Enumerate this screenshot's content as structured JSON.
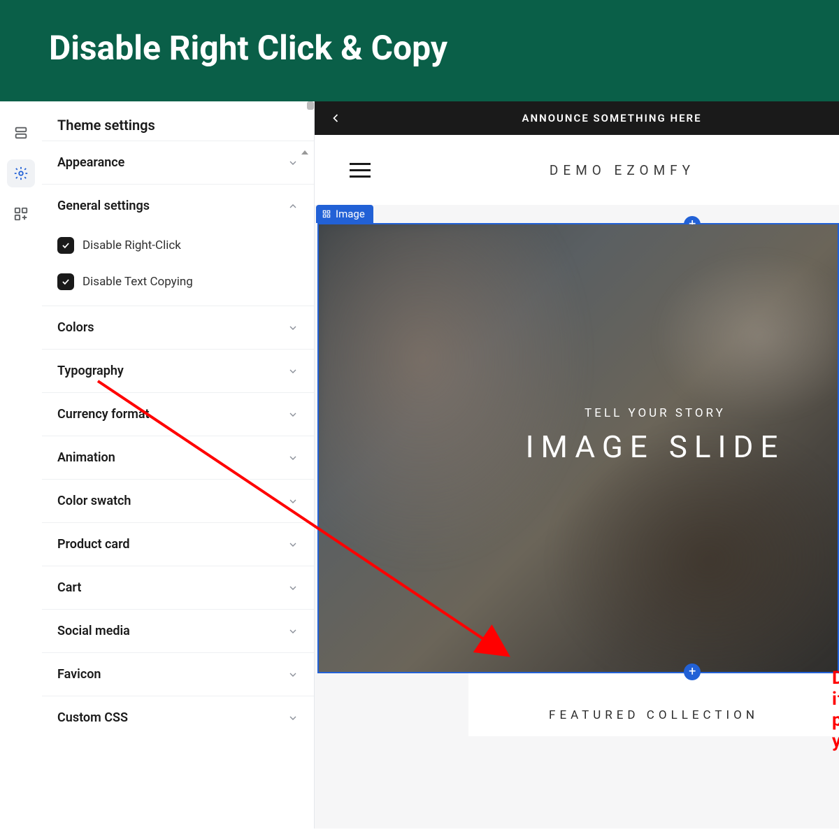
{
  "banner": {
    "title": "Disable Right Click & Copy"
  },
  "sidebar": {
    "title": "Theme settings",
    "sections": {
      "appearance": "Appearance",
      "general": "General settings",
      "colors": "Colors",
      "typography": "Typography",
      "currency": "Currency format",
      "animation": "Animation",
      "swatch": "Color swatch",
      "product_card": "Product card",
      "cart": "Cart",
      "social": "Social media",
      "favicon": "Favicon",
      "custom_css": "Custom CSS"
    },
    "checks": {
      "disable_right_click": "Disable Right-Click",
      "disable_text_copy": "Disable Text Copying"
    }
  },
  "preview": {
    "announce": "ANNOUNCE SOMETHING HERE",
    "brand": "DEMO EZOMFY",
    "image_tag": "Image",
    "hero_sub": "TELL YOUR STORY",
    "hero_big": "IMAGE SLIDE",
    "warn_text": "Disable it to protect you",
    "featured": "FEATURED COLLECTION"
  }
}
